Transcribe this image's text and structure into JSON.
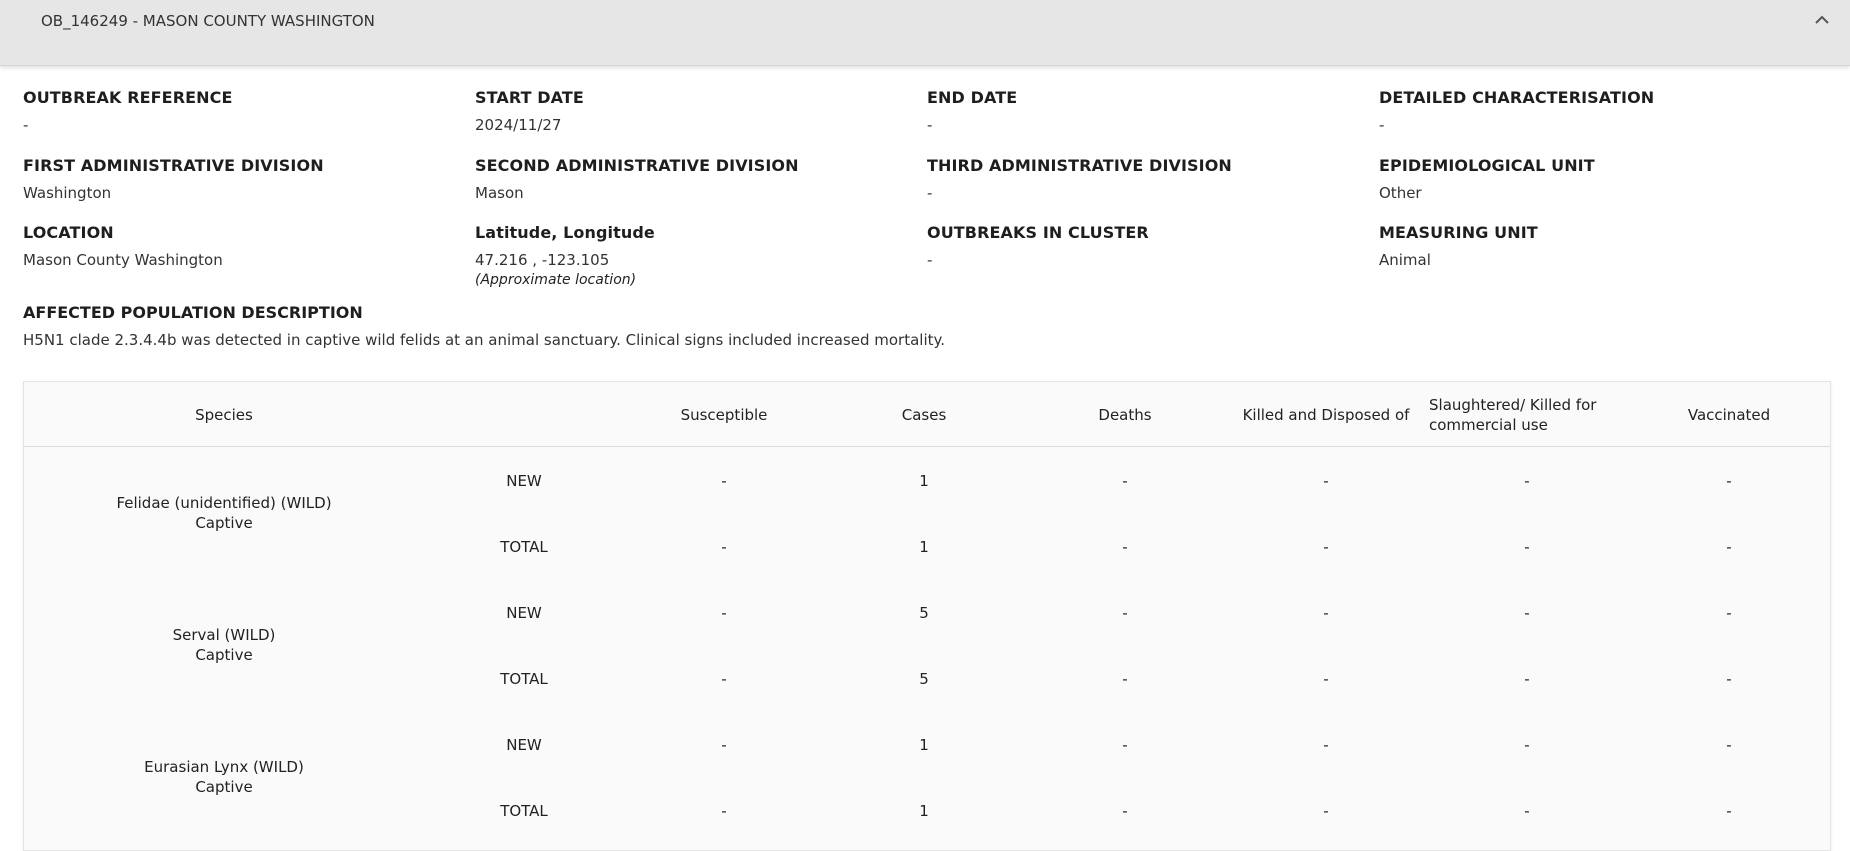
{
  "header": {
    "title": "OB_146249 - MASON COUNTY WASHINGTON"
  },
  "fields": {
    "outbreak_reference": {
      "label": "OUTBREAK REFERENCE",
      "value": "-"
    },
    "start_date": {
      "label": "START DATE",
      "value": "2024/11/27"
    },
    "end_date": {
      "label": "END DATE",
      "value": "-"
    },
    "detailed_characterisation": {
      "label": "DETAILED CHARACTERISATION",
      "value": "-"
    },
    "first_admin_division": {
      "label": "FIRST ADMINISTRATIVE DIVISION",
      "value": "Washington"
    },
    "second_admin_division": {
      "label": "SECOND ADMINISTRATIVE DIVISION",
      "value": "Mason"
    },
    "third_admin_division": {
      "label": "THIRD ADMINISTRATIVE DIVISION",
      "value": "-"
    },
    "epidemiological_unit": {
      "label": "EPIDEMIOLOGICAL UNIT",
      "value": "Other"
    },
    "location": {
      "label": "LOCATION",
      "value": "Mason County Washington"
    },
    "lat_long": {
      "label": "Latitude, Longitude",
      "value": "47.216 , -123.105",
      "note": "(Approximate location)"
    },
    "outbreaks_in_cluster": {
      "label": "OUTBREAKS IN CLUSTER",
      "value": "-"
    },
    "measuring_unit": {
      "label": "MEASURING UNIT",
      "value": "Animal"
    }
  },
  "affected_population": {
    "label": "AFFECTED POPULATION DESCRIPTION",
    "value": "H5N1 clade 2.3.4.4b was detected in captive wild felids at an animal sanctuary. Clinical signs included increased mortality."
  },
  "table": {
    "headers": {
      "species": "Species",
      "susceptible": "Susceptible",
      "cases": "Cases",
      "deaths": "Deaths",
      "killed": "Killed and Disposed of",
      "slaughtered": "Slaughtered/ Killed for commercial use",
      "vaccinated": "Vaccinated"
    },
    "groups": [
      {
        "species": "Felidae (unidentified) (WILD)",
        "status": "Captive",
        "rows": [
          {
            "type": "NEW",
            "susceptible": "-",
            "cases": "1",
            "deaths": "-",
            "killed": "-",
            "slaughtered": "-",
            "vaccinated": "-"
          },
          {
            "type": "TOTAL",
            "susceptible": "-",
            "cases": "1",
            "deaths": "-",
            "killed": "-",
            "slaughtered": "-",
            "vaccinated": "-"
          }
        ]
      },
      {
        "species": "Serval (WILD)",
        "status": "Captive",
        "rows": [
          {
            "type": "NEW",
            "susceptible": "-",
            "cases": "5",
            "deaths": "-",
            "killed": "-",
            "slaughtered": "-",
            "vaccinated": "-"
          },
          {
            "type": "TOTAL",
            "susceptible": "-",
            "cases": "5",
            "deaths": "-",
            "killed": "-",
            "slaughtered": "-",
            "vaccinated": "-"
          }
        ]
      },
      {
        "species": "Eurasian Lynx (WILD)",
        "status": "Captive",
        "rows": [
          {
            "type": "NEW",
            "susceptible": "-",
            "cases": "1",
            "deaths": "-",
            "killed": "-",
            "slaughtered": "-",
            "vaccinated": "-"
          },
          {
            "type": "TOTAL",
            "susceptible": "-",
            "cases": "1",
            "deaths": "-",
            "killed": "-",
            "slaughtered": "-",
            "vaccinated": "-"
          }
        ]
      }
    ]
  }
}
